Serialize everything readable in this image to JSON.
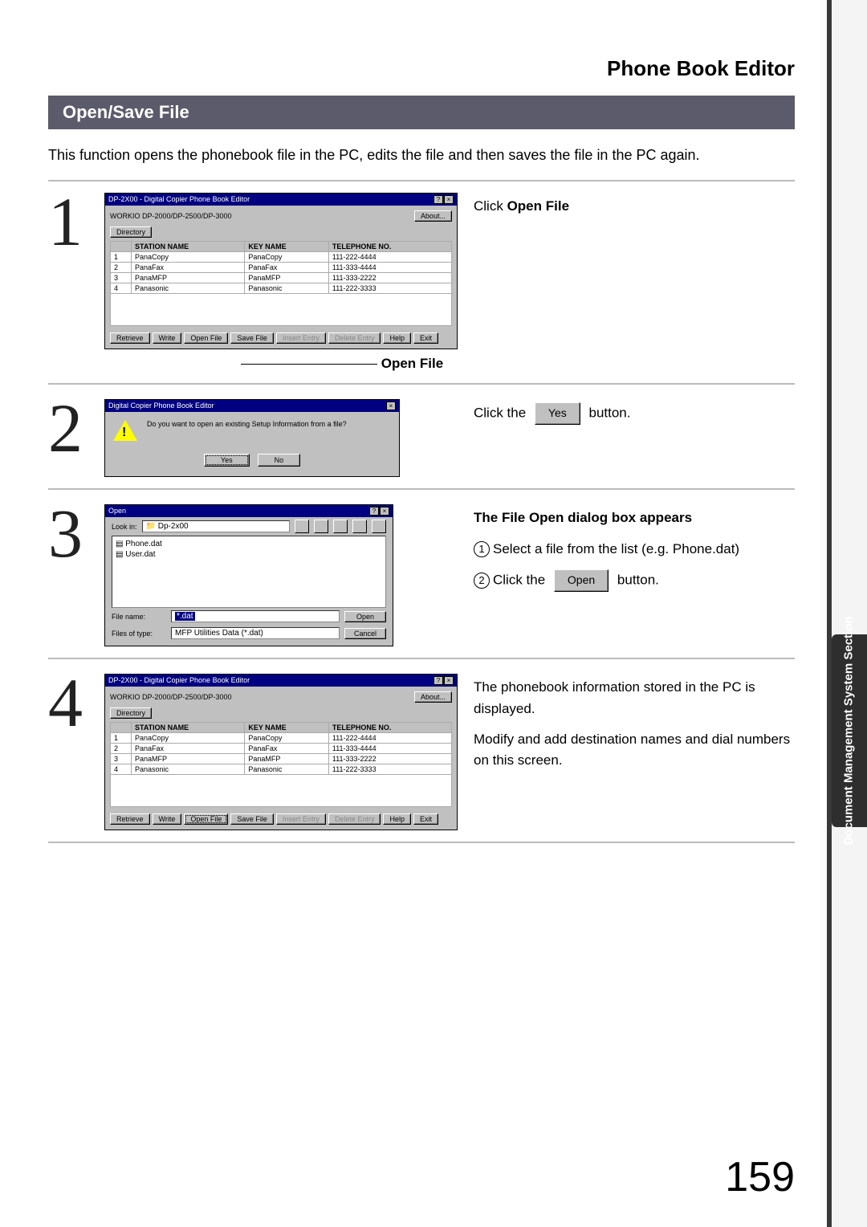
{
  "chapter": "Phone Book Editor",
  "section": "Open/Save File",
  "intro": "This function opens the phonebook file in the PC, edits the file and then saves the file in the PC again.",
  "step1": {
    "desc_prefix": "Click ",
    "desc_bold": "Open File",
    "callout": "Open File",
    "window": {
      "title": "DP-2X00 - Digital Copier Phone Book Editor",
      "subtitle": "WORKIO DP-2000/DP-2500/DP-3000",
      "about_btn": "About...",
      "tab": "Directory",
      "cols": [
        "",
        "STATION NAME",
        "KEY NAME",
        "TELEPHONE NO."
      ],
      "rows": [
        [
          "1",
          "PanaCopy",
          "PanaCopy",
          "111-222-4444"
        ],
        [
          "2",
          "PanaFax",
          "PanaFax",
          "111-333-4444"
        ],
        [
          "3",
          "PanaMFP",
          "PanaMFP",
          "111-333-2222"
        ],
        [
          "4",
          "Panasonic",
          "Panasonic",
          "111-222-3333"
        ]
      ],
      "buttons": [
        "Retrieve",
        "Write",
        "Open File",
        "Save File",
        "Insert Entry",
        "Delete Entry",
        "Help",
        "Exit"
      ]
    }
  },
  "step2": {
    "desc_a": "Click the",
    "desc_btn": "Yes",
    "desc_b": "button.",
    "dlg": {
      "title": "Digital Copier Phone Book Editor",
      "msg": "Do you want to open an existing Setup Information from a file?",
      "yes": "Yes",
      "no": "No"
    }
  },
  "step3": {
    "heading": "The File Open dialog box appears",
    "line1": "Select a file from the list (e.g. Phone.dat)",
    "line2a": "Click the",
    "line2_btn": "Open",
    "line2b": "button.",
    "dlg": {
      "title": "Open",
      "lookin_label": "Look in:",
      "lookin_val": "Dp-2x00",
      "files": [
        "Phone.dat",
        "User.dat"
      ],
      "fname_label": "File name:",
      "fname_val": "*.dat",
      "ftype_label": "Files of type:",
      "ftype_val": "MFP Utilities Data (*.dat)",
      "open_btn": "Open",
      "cancel_btn": "Cancel"
    }
  },
  "step4": {
    "p1": "The phonebook information stored in the PC is displayed.",
    "p2": "Modify and add destination names and dial numbers on this screen.",
    "window": {
      "title": "DP-2X00 - Digital Copier Phone Book Editor",
      "subtitle": "WORKIO DP-2000/DP-2500/DP-3000",
      "about_btn": "About...",
      "tab": "Directory",
      "cols": [
        "",
        "STATION NAME",
        "KEY NAME",
        "TELEPHONE NO."
      ],
      "rows": [
        [
          "1",
          "PanaCopy",
          "PanaCopy",
          "111-222-4444"
        ],
        [
          "2",
          "PanaFax",
          "PanaFax",
          "111-333-4444"
        ],
        [
          "3",
          "PanaMFP",
          "PanaMFP",
          "111-333-2222"
        ],
        [
          "4",
          "Panasonic",
          "Panasonic",
          "111-222-3333"
        ]
      ],
      "buttons": [
        "Retrieve",
        "Write",
        "Open File",
        "Save File",
        "Insert Entry",
        "Delete Entry",
        "Help",
        "Exit"
      ]
    }
  },
  "side_tab": "Document Management\nSystem Section",
  "page_number": "159"
}
